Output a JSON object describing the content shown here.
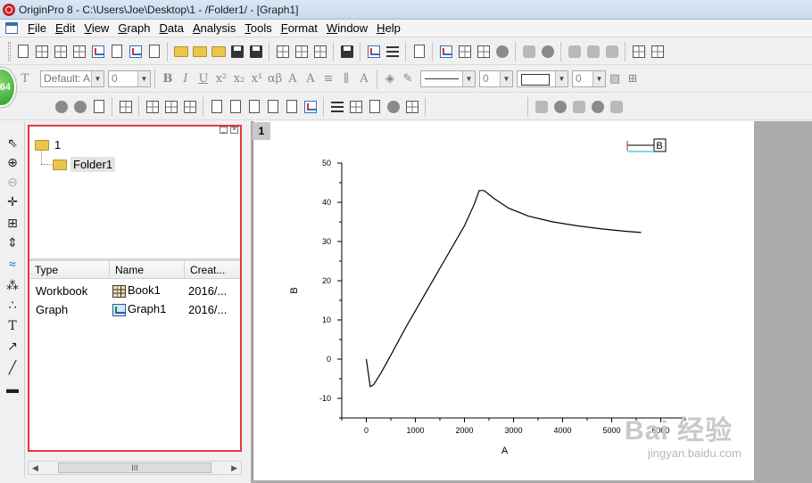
{
  "window": {
    "title": "OriginPro 8 - C:\\Users\\Joe\\Desktop\\1 - /Folder1/ - [Graph1]"
  },
  "menu": [
    "File",
    "Edit",
    "View",
    "Graph",
    "Data",
    "Analysis",
    "Tools",
    "Format",
    "Window",
    "Help"
  ],
  "format_toolbar": {
    "font": "Default: A",
    "font_size": "0",
    "line_width": "0",
    "border_width": "0"
  },
  "badge": {
    "text": "64"
  },
  "explorer": {
    "root_folder": "1",
    "child_folder": "Folder1",
    "columns": [
      "Type",
      "Name",
      "Creat..."
    ],
    "rows": [
      {
        "type": "Workbook",
        "name": "Book1",
        "created": "2016/...",
        "icon": "workbook-icon"
      },
      {
        "type": "Graph",
        "name": "Graph1",
        "created": "2016/...",
        "icon": "graph-icon"
      }
    ],
    "scroll_label": "III"
  },
  "graph": {
    "page_number": "1",
    "legend": "B"
  },
  "chart_data": {
    "type": "line",
    "title": "",
    "xlabel": "A",
    "ylabel": "B",
    "xlim": [
      -500,
      6500
    ],
    "ylim": [
      -15,
      50
    ],
    "xticks": [
      0,
      1000,
      2000,
      3000,
      4000,
      5000,
      6000
    ],
    "yticks": [
      -10,
      0,
      10,
      20,
      30,
      40,
      50
    ],
    "series": [
      {
        "name": "B",
        "color": "#000000",
        "x": [
          0,
          80,
          150,
          300,
          500,
          800,
          1100,
          1400,
          1700,
          2000,
          2200,
          2300,
          2400,
          2600,
          2900,
          3300,
          3800,
          4300,
          4800,
          5300,
          5600
        ],
        "y": [
          0,
          -7,
          -6.5,
          -3.5,
          1,
          8,
          14.5,
          21,
          27.5,
          34,
          39.5,
          43,
          43,
          41,
          38.5,
          36.5,
          35,
          34,
          33.2,
          32.6,
          32.3
        ]
      }
    ]
  },
  "watermark": {
    "text": "Bai 经验",
    "url": "jingyan.baidu.com"
  }
}
